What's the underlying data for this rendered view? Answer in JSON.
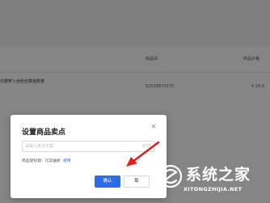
{
  "background": {
    "table": {
      "headers": {
        "id": "商品ID",
        "price": "商品价格"
      },
      "row": {
        "product": "元黎萝卜丝粉丝算值表卷",
        "id": "52528873270",
        "price": "¥ 39.9"
      }
    }
  },
  "dialog": {
    "title": "设置商品卖点",
    "close_label": "×",
    "input": {
      "placeholder": "请输入卖点文案",
      "value": "",
      "counter": "0/15"
    },
    "hint": {
      "text": "商品促标题：切实抽新",
      "link": "使用"
    },
    "ok_label": "确认",
    "cancel_label": "取"
  },
  "watermark": {
    "title": "系统之家",
    "url": "XITONGZHIJIA.NET"
  },
  "colors": {
    "primary": "#2d6bea",
    "arrow": "#e02020"
  }
}
